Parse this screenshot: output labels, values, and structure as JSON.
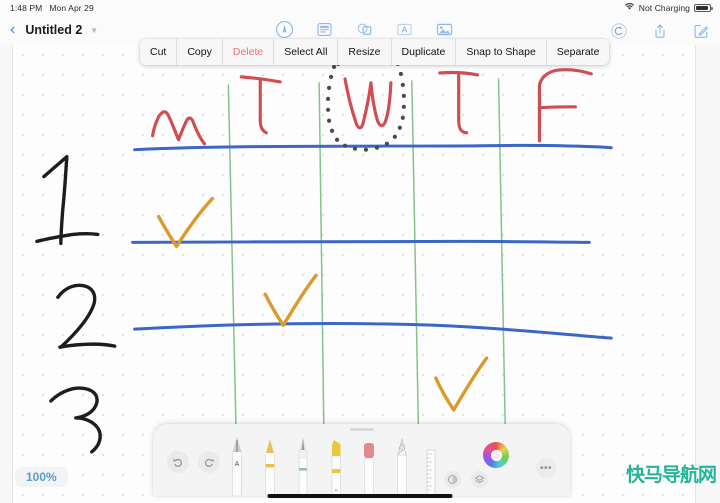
{
  "statusbar": {
    "time": "1:48 PM",
    "date": "Mon Apr 29",
    "wifi_icon": "wifi-icon",
    "battery_label": "Not Charging",
    "battery_icon": "battery-icon"
  },
  "navbar": {
    "back_icon": "back-chevron-icon",
    "title": "Untitled 2",
    "title_caret_icon": "chevron-down-icon",
    "center_tools": [
      {
        "name": "markup-pencil-icon",
        "label": "Markup"
      },
      {
        "name": "document-text-icon",
        "label": "Text Document"
      },
      {
        "name": "shapes-icon",
        "label": "Shapes"
      },
      {
        "name": "text-box-icon",
        "label": "Text Box"
      },
      {
        "name": "media-photo-icon",
        "label": "Media"
      }
    ],
    "right_tools": [
      {
        "name": "undo-icon",
        "label": "Undo"
      },
      {
        "name": "share-icon",
        "label": "Share"
      },
      {
        "name": "compose-icon",
        "label": "New Note"
      }
    ]
  },
  "context_menu": {
    "items": [
      {
        "label": "Cut",
        "name": "ctx-cut",
        "danger": false
      },
      {
        "label": "Copy",
        "name": "ctx-copy",
        "danger": false
      },
      {
        "label": "Delete",
        "name": "ctx-delete",
        "danger": true
      },
      {
        "label": "Select All",
        "name": "ctx-select-all",
        "danger": false
      },
      {
        "label": "Resize",
        "name": "ctx-resize",
        "danger": false
      },
      {
        "label": "Duplicate",
        "name": "ctx-duplicate",
        "danger": false
      },
      {
        "label": "Snap to Shape",
        "name": "ctx-snap-to-shape",
        "danger": false
      },
      {
        "label": "Separate",
        "name": "ctx-separate",
        "danger": false
      }
    ]
  },
  "canvas": {
    "background": "dot-grid",
    "column_headers": [
      "M",
      "T",
      "W",
      "T",
      "F"
    ],
    "row_labels": [
      "1",
      "2",
      "3"
    ],
    "selected_item": "W",
    "selection_style": "dotted-lasso",
    "checkmarks": [
      {
        "column": "M",
        "row": "1"
      },
      {
        "column": "T",
        "row": "2"
      },
      {
        "column": "T",
        "row": "3"
      }
    ],
    "ink_colors": {
      "header_red": "#cf4e52",
      "row_label_black": "#1d1d1d",
      "row_line_blue": "#3a66c8",
      "column_line_green": "#84c48a",
      "check_orange": "#d99a2e",
      "lasso_gray": "#4a4a4a"
    }
  },
  "palette": {
    "undo_icon": "undo-arrow-icon",
    "redo_icon": "redo-arrow-icon",
    "tools": [
      {
        "name": "tool-fountain-pen",
        "label": "Fountain Pen",
        "accent": "#b9b9b9",
        "tip": "dark"
      },
      {
        "name": "tool-marker",
        "label": "Marker",
        "accent": "#e6c34a",
        "tip": "yellow"
      },
      {
        "name": "tool-pen",
        "label": "Pen",
        "accent": "#8fc79a",
        "tip": "silver"
      },
      {
        "name": "tool-highlighter",
        "label": "Highlighter",
        "accent": "#e7c93f",
        "tip": "yellow"
      },
      {
        "name": "tool-eraser",
        "label": "Eraser",
        "accent": "#e08b8b",
        "tip": "pink"
      },
      {
        "name": "tool-pencil",
        "label": "Pencil",
        "accent": "#c7c7c7",
        "tip": "hatched"
      },
      {
        "name": "tool-ruler",
        "label": "Ruler",
        "accent": "#cfcfcf",
        "tip": "ruler"
      }
    ],
    "color_wheel": {
      "name": "color-wheel",
      "selected_color": "#f6eaf0"
    },
    "small_buttons": [
      {
        "name": "opacity-button",
        "label": "Opacity"
      },
      {
        "name": "layers-button",
        "label": "Layers"
      }
    ],
    "more_button": {
      "name": "more-options-button",
      "label": "•••"
    }
  },
  "zoom": {
    "level": "100%"
  },
  "watermark": {
    "text": "快马导航网"
  }
}
